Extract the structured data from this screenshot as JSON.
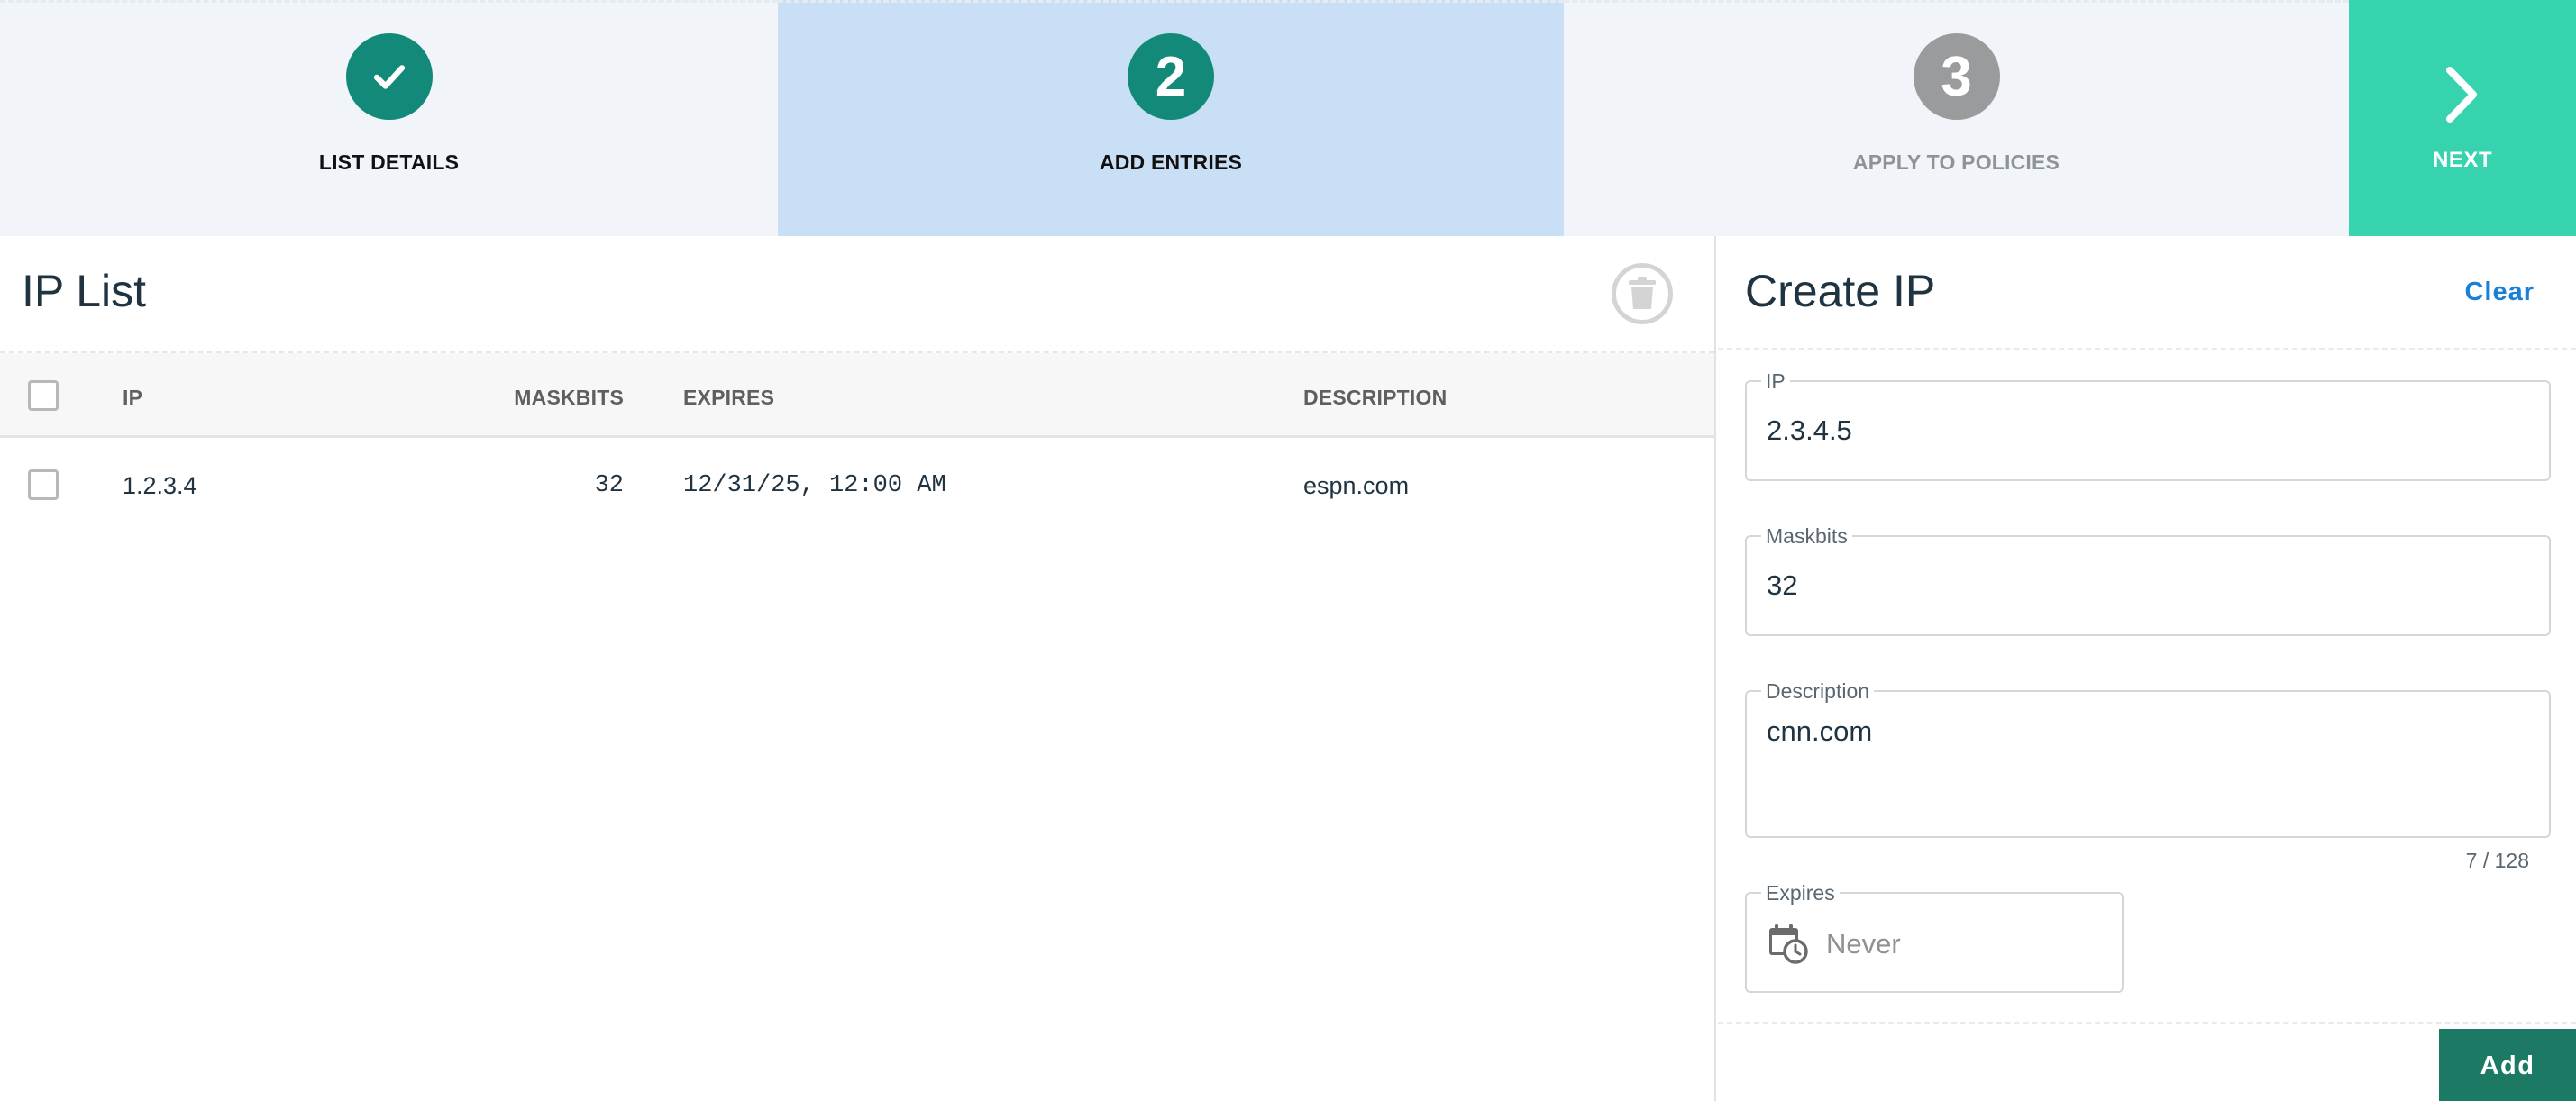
{
  "stepper": {
    "steps": [
      {
        "number": "",
        "label": "LIST DETAILS",
        "state": "complete",
        "icon": "check-icon"
      },
      {
        "number": "2",
        "label": "ADD ENTRIES",
        "state": "active"
      },
      {
        "number": "3",
        "label": "APPLY TO POLICIES",
        "state": "upcoming"
      }
    ],
    "next_label": "NEXT",
    "next_icon": "chevron-right-icon"
  },
  "ip_list": {
    "title": "IP List",
    "delete_icon": "trash-icon",
    "columns": {
      "ip": "IP",
      "maskbits": "MASKBITS",
      "expires": "EXPIRES",
      "description": "DESCRIPTION"
    },
    "rows": [
      {
        "ip": "1.2.3.4",
        "maskbits": "32",
        "expires": "12/31/25, 12:00 AM",
        "description": "espn.com",
        "selected": false
      }
    ]
  },
  "create_form": {
    "title": "Create IP",
    "clear_label": "Clear",
    "ip": {
      "label": "IP",
      "value": "2.3.4.5"
    },
    "maskbits": {
      "label": "Maskbits",
      "value": "32"
    },
    "description": {
      "label": "Description",
      "value": "cnn.com",
      "counter": "7 / 128"
    },
    "expires": {
      "label": "Expires",
      "placeholder": "Never",
      "icon": "calendar-clock-icon"
    },
    "add_label": "Add"
  },
  "colors": {
    "step_active_bg": "#c9dff5",
    "step_done": "#138a79",
    "step_todo": "#9a9b9d",
    "next_bg": "#36d3ae",
    "add_bg": "#1c7a64",
    "link": "#1a7fd6"
  }
}
